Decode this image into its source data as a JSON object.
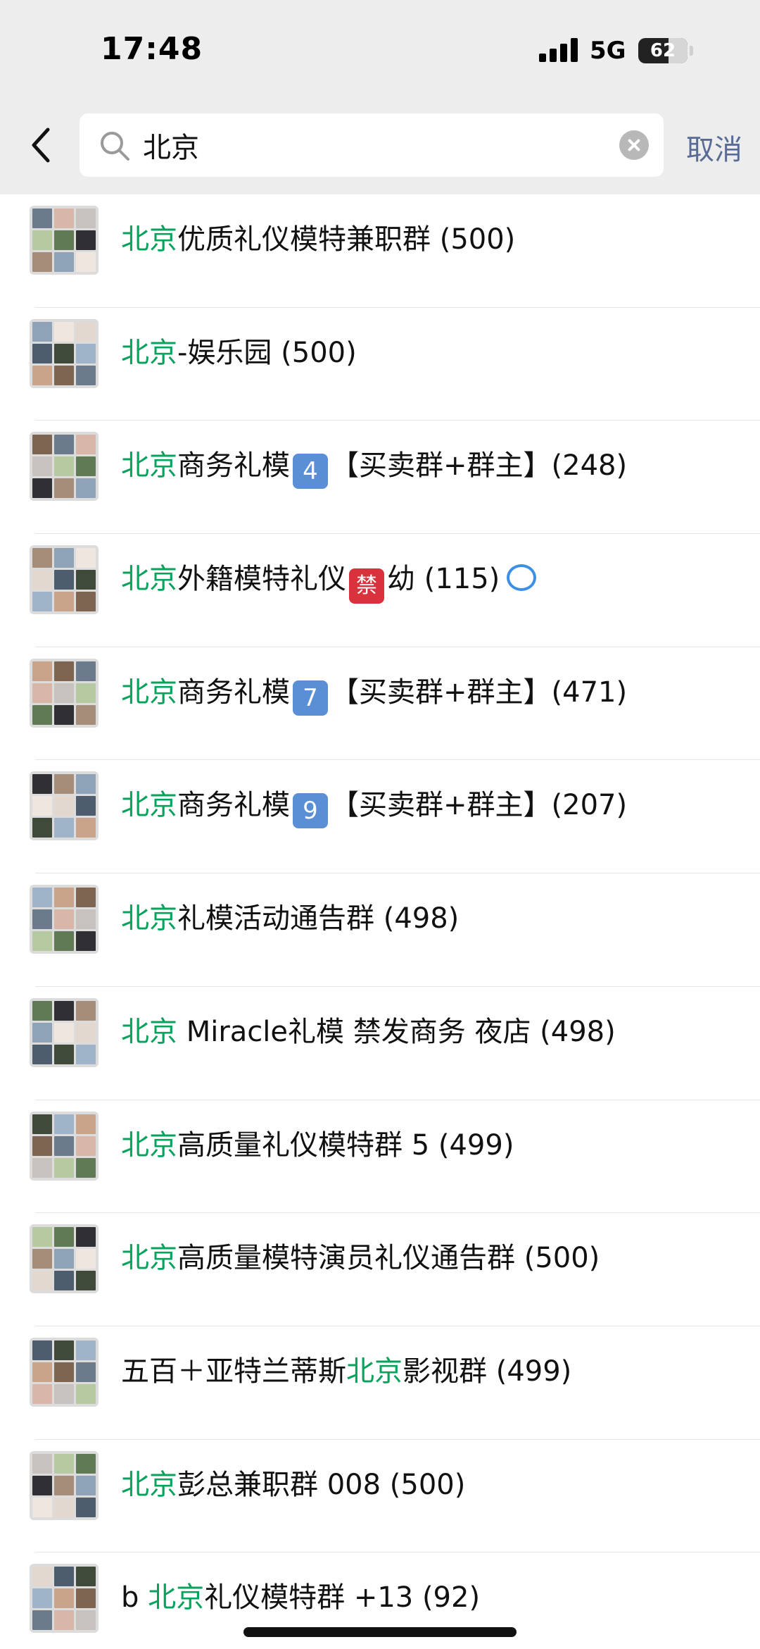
{
  "status_bar": {
    "time": "17:48",
    "network": "5G",
    "battery": "62",
    "battery_level_pct": 62
  },
  "search": {
    "query": "北京",
    "cancel_label": "取消"
  },
  "colors": {
    "highlight": "#07a25c",
    "cancel_link": "#576b95",
    "header_bg": "#ededed"
  },
  "results": [
    {
      "pre": "",
      "hl": "北京",
      "post": "优质礼仪模特兼职群 (500)"
    },
    {
      "pre": "",
      "hl": "北京",
      "post": "-娱乐园 (500)"
    },
    {
      "pre": "",
      "hl": "北京",
      "post": "商务礼模",
      "emoji": "4",
      "emoji_type": "keycap",
      "tail": "【买卖群+群主】(248)"
    },
    {
      "pre": "",
      "hl": "北京",
      "post": "外籍模特礼仪",
      "emoji": "禁",
      "emoji_type": "prohibited",
      "tail": "幼 (115)",
      "badge_icon": "chat-bubble-icon"
    },
    {
      "pre": "",
      "hl": "北京",
      "post": "商务礼模",
      "emoji": "7",
      "emoji_type": "keycap",
      "tail": "【买卖群+群主】(471)"
    },
    {
      "pre": "",
      "hl": "北京",
      "post": "商务礼模",
      "emoji": "9",
      "emoji_type": "keycap",
      "tail": "【买卖群+群主】(207)"
    },
    {
      "pre": "",
      "hl": "北京",
      "post": "礼模活动通告群 (498)"
    },
    {
      "pre": "",
      "hl": "北京",
      "post": " Miracle礼模 禁发商务 夜店 (498)"
    },
    {
      "pre": "",
      "hl": "北京",
      "post": "高质量礼仪模特群 5 (499)"
    },
    {
      "pre": "",
      "hl": "北京",
      "post": "高质量模特演员礼仪通告群 (500)"
    },
    {
      "pre": "五百＋亚特兰蒂斯",
      "hl": "北京",
      "post": "影视群 (499)"
    },
    {
      "pre": "",
      "hl": "北京",
      "post": "彭总兼职群 008 (500)"
    },
    {
      "pre": "b ",
      "hl": "北京",
      "post": "礼仪模特群 +13 (92)"
    }
  ]
}
